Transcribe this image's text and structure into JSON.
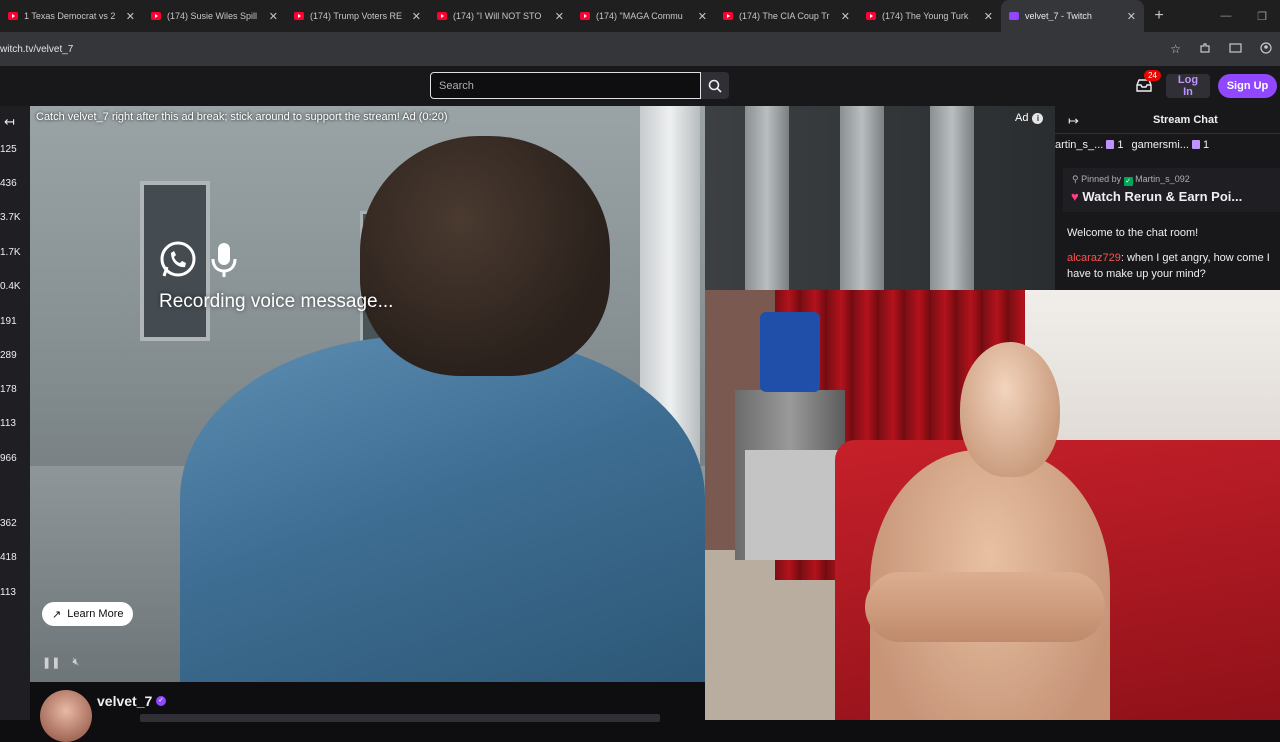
{
  "browser": {
    "tabs": [
      {
        "title": "1 Texas Democrat vs 2"
      },
      {
        "title": "(174) Susie Wiles Spill"
      },
      {
        "title": "(174) Trump Voters RE"
      },
      {
        "title": "(174) \"I Will NOT STO"
      },
      {
        "title": "(174) \"MAGA Commu"
      },
      {
        "title": "(174) The CIA Coup Tr"
      },
      {
        "title": "(174) The Young Turk"
      },
      {
        "title": "velvet_7 - Twitch"
      }
    ],
    "url": "witch.tv/velvet_7"
  },
  "topnav": {
    "search_placeholder": "Search",
    "inbox_badge": "24",
    "login_label": "Log In",
    "signup_label": "Sign Up"
  },
  "sidebar": {
    "viewer_counts": [
      "125",
      "436",
      "3.7K",
      "1.7K",
      "0.4K",
      "191",
      "289",
      "178",
      "113",
      "966",
      "362",
      "418",
      "113"
    ]
  },
  "player": {
    "ad_notice": "Catch velvet_7 right after this ad break; stick around to support the stream! Ad (0:20)",
    "ad_label": "Ad",
    "overlay_text": "Recording voice message...",
    "learn_more": "Learn More"
  },
  "channel": {
    "name": "velvet_7"
  },
  "chat": {
    "title": "Stream Chat",
    "gifters": [
      {
        "name": "artin_s_...",
        "count": "1"
      },
      {
        "name": "gamersmi...",
        "count": "1"
      }
    ],
    "pinned_by_label": "Pinned by",
    "pinned_by_user": "Martin_s_092",
    "pinned_message": "Watch Rerun & Earn Poi...",
    "welcome": "Welcome to the chat room!",
    "message_user": "alcaraz729",
    "message_text": ": when I get angry, how come I have to make up your mind?"
  },
  "colors": {
    "twitch_purple": "#9147ff",
    "background": "#0e0e10",
    "chat_username": "#ff4f4f"
  }
}
